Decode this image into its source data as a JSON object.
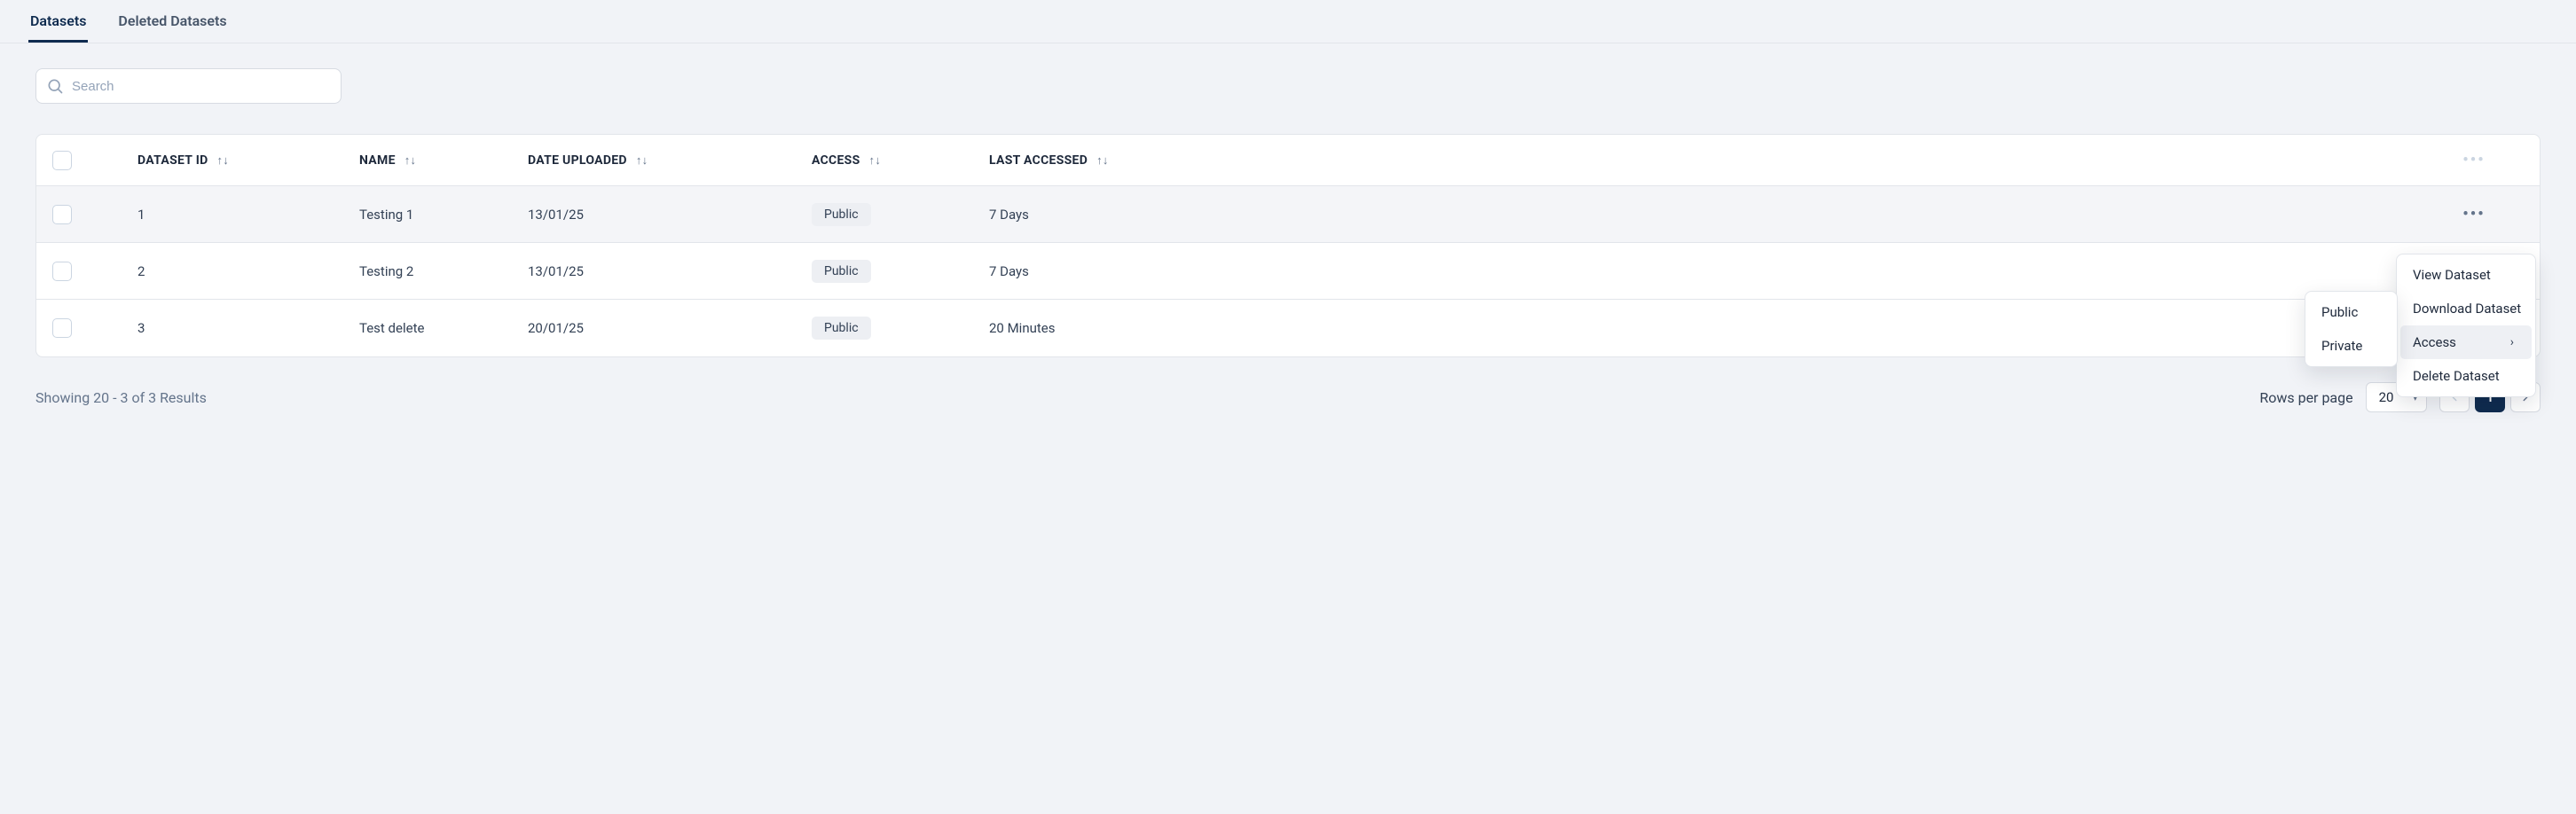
{
  "tabs": {
    "datasets": "Datasets",
    "deleted": "Deleted Datasets"
  },
  "search": {
    "placeholder": "Search"
  },
  "columns": {
    "dataset_id": "DATASET ID",
    "name": "NAME",
    "date_uploaded": "DATE UPLOADED",
    "access": "ACCESS",
    "last_accessed": "LAST ACCESSED"
  },
  "rows": [
    {
      "id": "1",
      "name": "Testing 1",
      "date": "13/01/25",
      "access": "Public",
      "last": "7 Days"
    },
    {
      "id": "2",
      "name": "Testing 2",
      "date": "13/01/25",
      "access": "Public",
      "last": "7 Days"
    },
    {
      "id": "3",
      "name": "Test delete",
      "date": "20/01/25",
      "access": "Public",
      "last": "20 Minutes"
    }
  ],
  "menu": {
    "view": "View Dataset",
    "download": "Download Dataset",
    "access": "Access",
    "delete": "Delete Dataset"
  },
  "submenu": {
    "public": "Public",
    "private": "Private"
  },
  "pager": {
    "summary": "Showing 20 - 3 of 3 Results",
    "rpp_label": "Rows per page",
    "rpp_value": "20",
    "current_page": "1"
  }
}
